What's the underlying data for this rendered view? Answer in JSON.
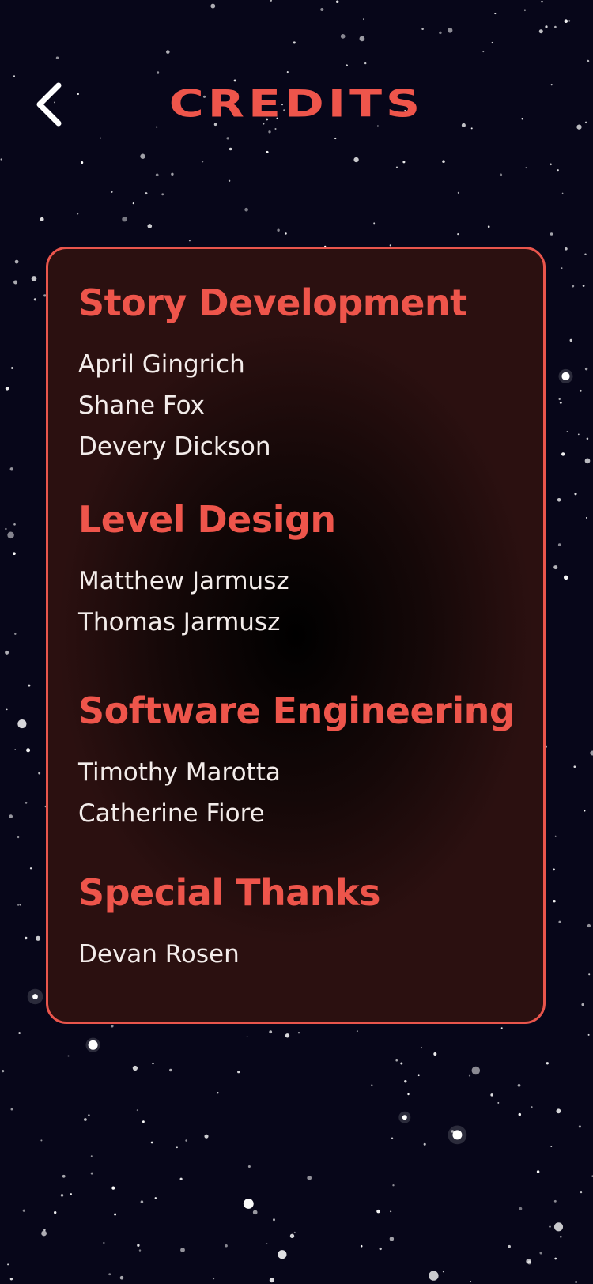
{
  "header": {
    "title": "CREDITS",
    "back_icon": "chevron-left-icon"
  },
  "colors": {
    "accent": "#ee554b",
    "background": "#070619",
    "text": "#f3ecea"
  },
  "sections": [
    {
      "heading": "Story Development",
      "names": [
        "April Gingrich",
        "Shane Fox",
        "Devery Dickson"
      ]
    },
    {
      "heading": "Level Design",
      "names": [
        "Matthew Jarmusz",
        "Thomas Jarmusz"
      ]
    },
    {
      "heading": "Software Engineering",
      "names": [
        "Timothy Marotta",
        "Catherine Fiore"
      ]
    },
    {
      "heading": "Special Thanks",
      "names": [
        "Devan Rosen"
      ]
    }
  ]
}
